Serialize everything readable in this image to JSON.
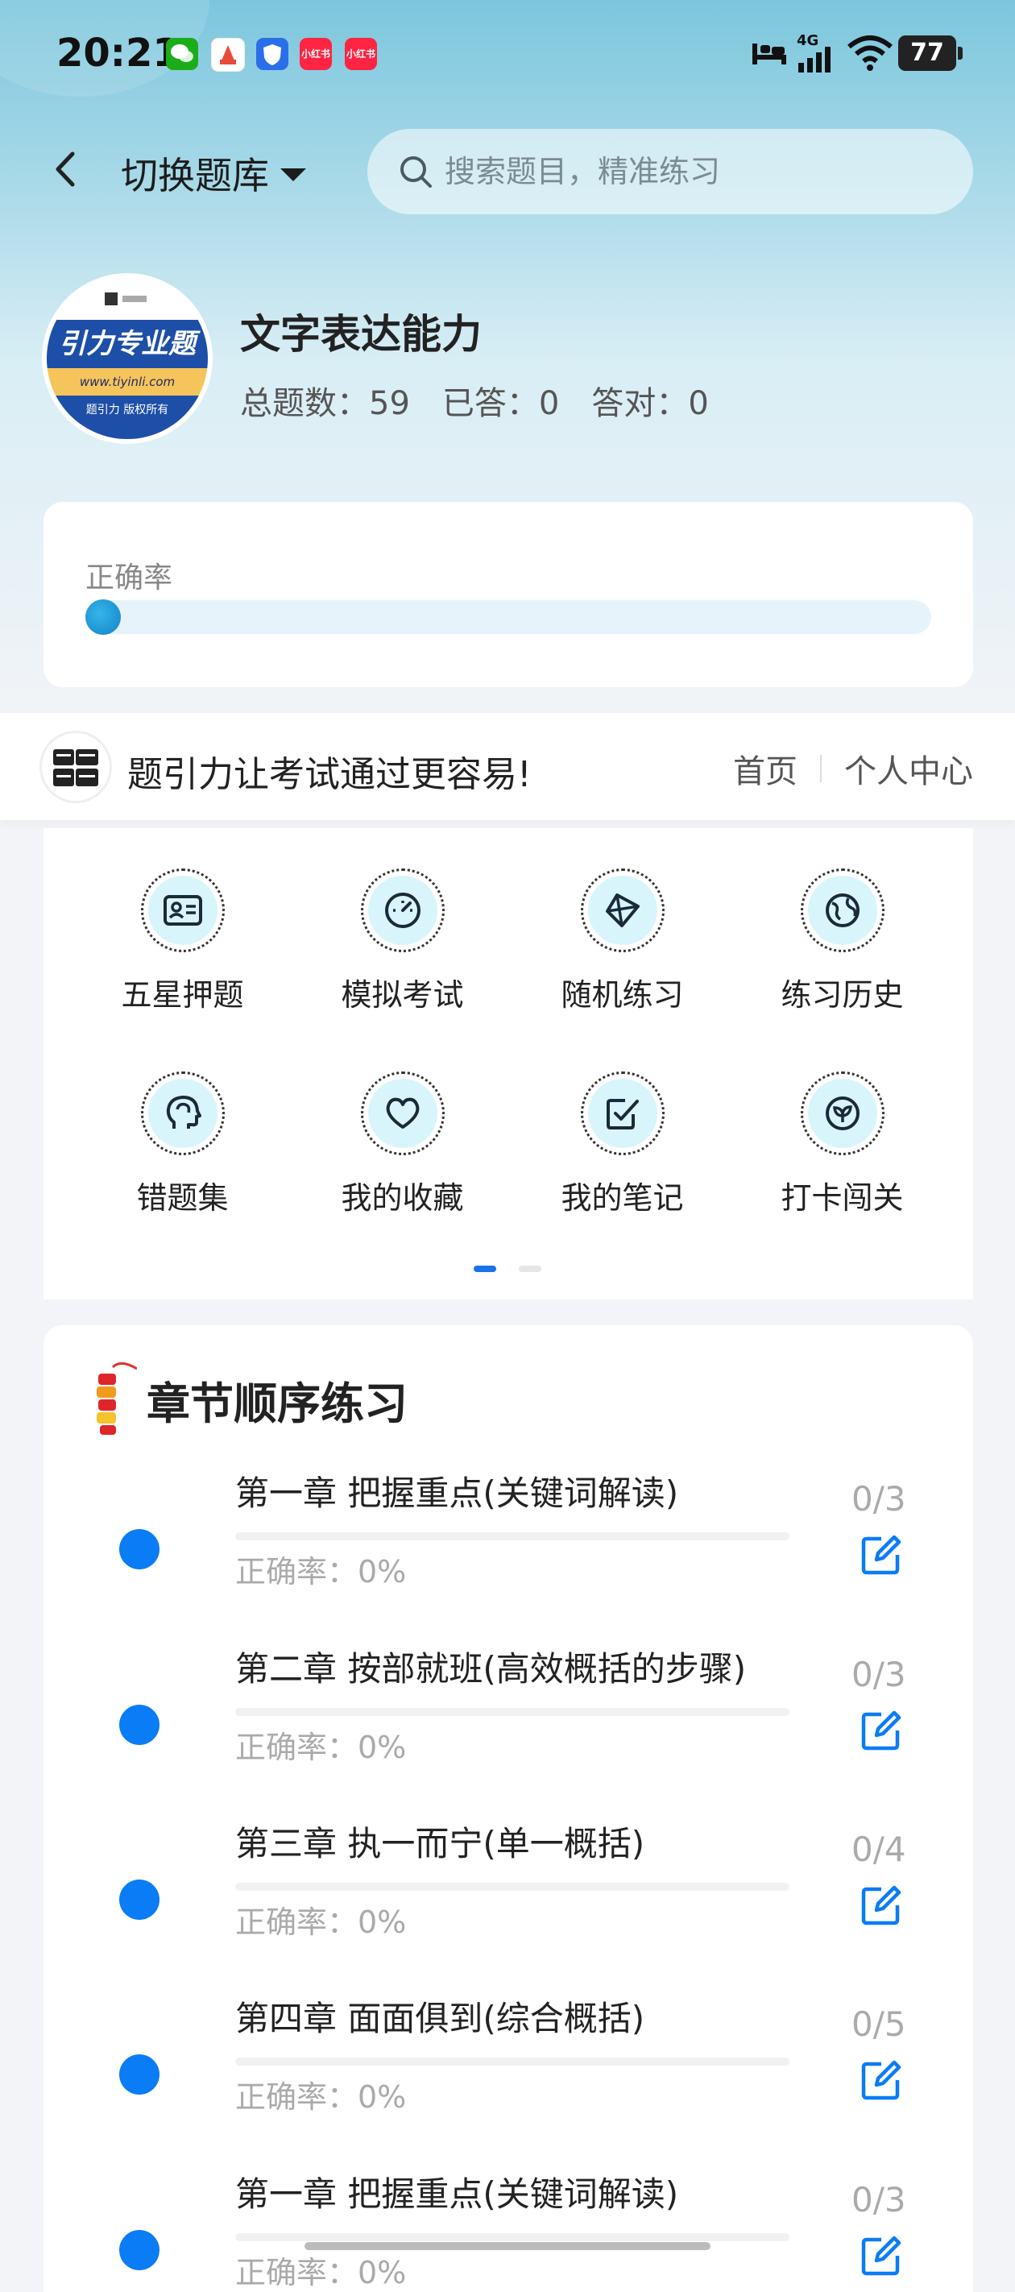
{
  "status_bar": {
    "time": "20:21",
    "app_icons": [
      {
        "name": "wechat-icon",
        "color": "#1aad19",
        "label": ""
      },
      {
        "name": "app-a-icon",
        "color": "#e84a3a",
        "label": ""
      },
      {
        "name": "app-shield-icon",
        "color": "#2a6ee8",
        "label": ""
      },
      {
        "name": "xiaohongshu-icon",
        "color": "#ff2442",
        "label": "小红书"
      },
      {
        "name": "xiaohongshu-icon-2",
        "color": "#ff2442",
        "label": "小红书"
      }
    ],
    "network": "4G",
    "battery": "77"
  },
  "header": {
    "switch_label": "切换题库",
    "search_placeholder": "搜索题目，精准练习"
  },
  "bank": {
    "logo_text": "引力专业题",
    "logo_url": "www.tiyinli.com",
    "logo_copyright": "题引力 版权所有",
    "name": "文字表达能力",
    "total_label": "总题数：59",
    "answered_label": "已答：0",
    "correct_label": "答对：0"
  },
  "accuracy": {
    "label": "正确率",
    "value": 0
  },
  "banner": {
    "logo_text": "题引力",
    "slogan": "题引力让考试通过更容易!",
    "nav_home": "首页",
    "nav_profile": "个人中心"
  },
  "features": [
    {
      "label": "五星押题",
      "icon": "id-card-icon"
    },
    {
      "label": "模拟考试",
      "icon": "gauge-icon"
    },
    {
      "label": "随机练习",
      "icon": "network-icon"
    },
    {
      "label": "练习历史",
      "icon": "globe-icon"
    },
    {
      "label": "错题集",
      "icon": "head-icon"
    },
    {
      "label": "我的收藏",
      "icon": "heart-icon"
    },
    {
      "label": "我的笔记",
      "icon": "checkbox-icon"
    },
    {
      "label": "打卡闯关",
      "icon": "leaf-icon"
    }
  ],
  "pager": {
    "active": 0,
    "count": 2
  },
  "chapters": {
    "title": "章节顺序练习",
    "items": [
      {
        "name": "第一章 把握重点(关键词解读)",
        "rate": "正确率：0%",
        "count": "0/3"
      },
      {
        "name": "第二章 按部就班(高效概括的步骤)",
        "rate": "正确率：0%",
        "count": "0/3"
      },
      {
        "name": "第三章 执一而宁(单一概括)",
        "rate": "正确率：0%",
        "count": "0/4"
      },
      {
        "name": "第四章 面面俱到(综合概括)",
        "rate": "正确率：0%",
        "count": "0/5"
      },
      {
        "name": "第一章 把握重点(关键词解读)",
        "rate": "正确率：0%",
        "count": "0/3"
      }
    ]
  },
  "colors": {
    "accent": "#0a7cf5",
    "icon_bg": "#d8f5fc",
    "pager_active": "#1a73e8",
    "pager_inactive": "#e6e6e6"
  }
}
